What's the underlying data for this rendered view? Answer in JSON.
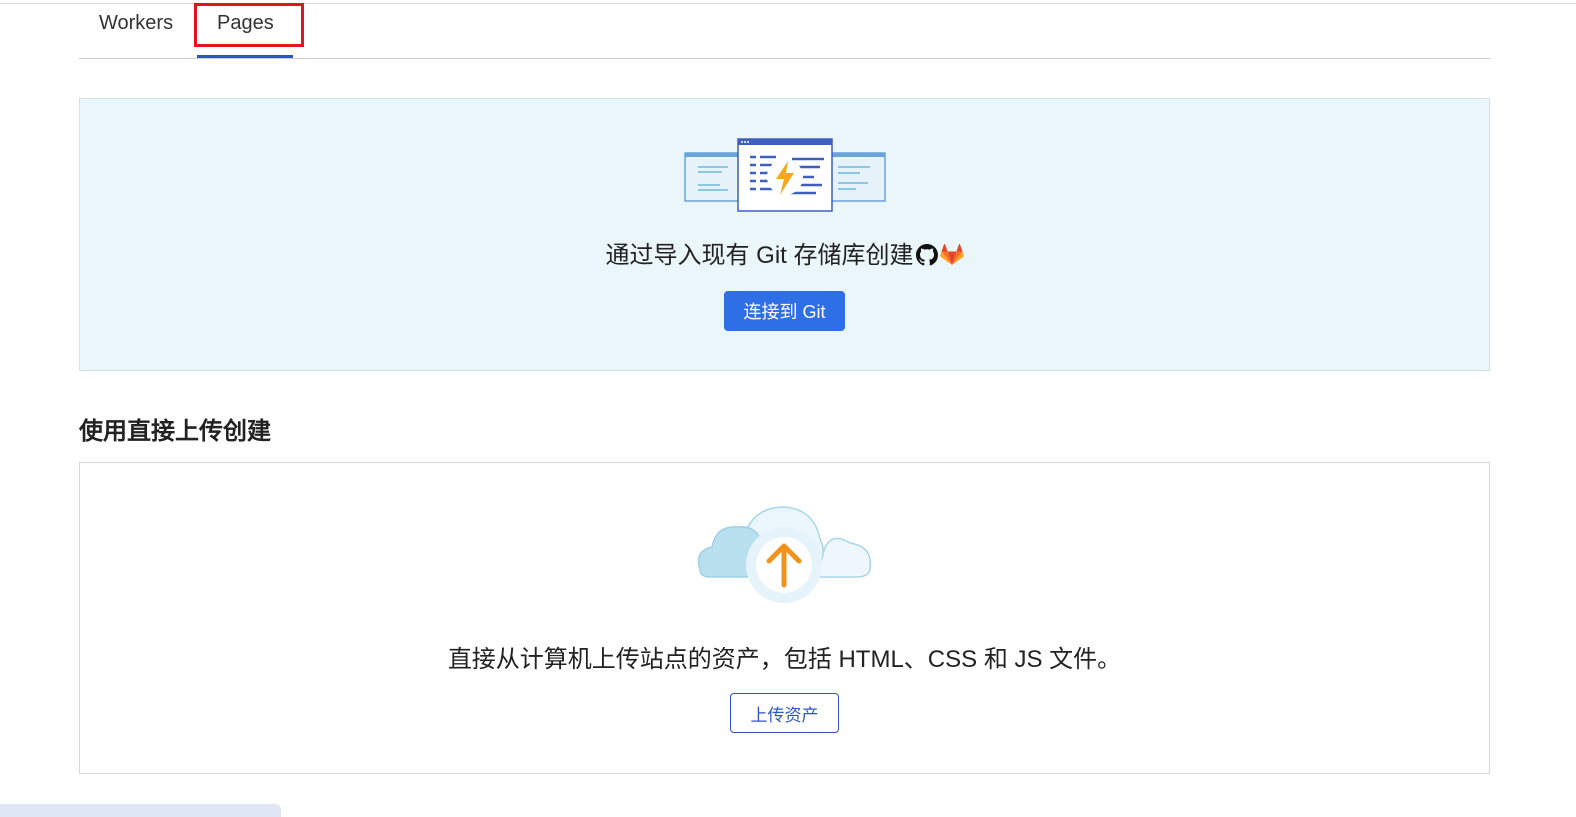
{
  "tabs": [
    {
      "label": "Workers",
      "active": false
    },
    {
      "label": "Pages",
      "active": true
    }
  ],
  "git": {
    "title": "通过导入现有 Git 存储库创建",
    "providers": [
      "github-icon",
      "gitlab-icon"
    ],
    "button_label": "连接到 Git"
  },
  "direct_upload": {
    "heading": "使用直接上传创建",
    "description": "直接从计算机上传站点的资产，包括 HTML、CSS 和 JS 文件。",
    "button_label": "上传资产"
  },
  "colors": {
    "accent": "#2f6fe6",
    "tab_underline": "#2f55c4",
    "highlight": "#e3141b",
    "git_panel_bg": "#eaf6fa",
    "upload_arrow": "#f0931e"
  }
}
